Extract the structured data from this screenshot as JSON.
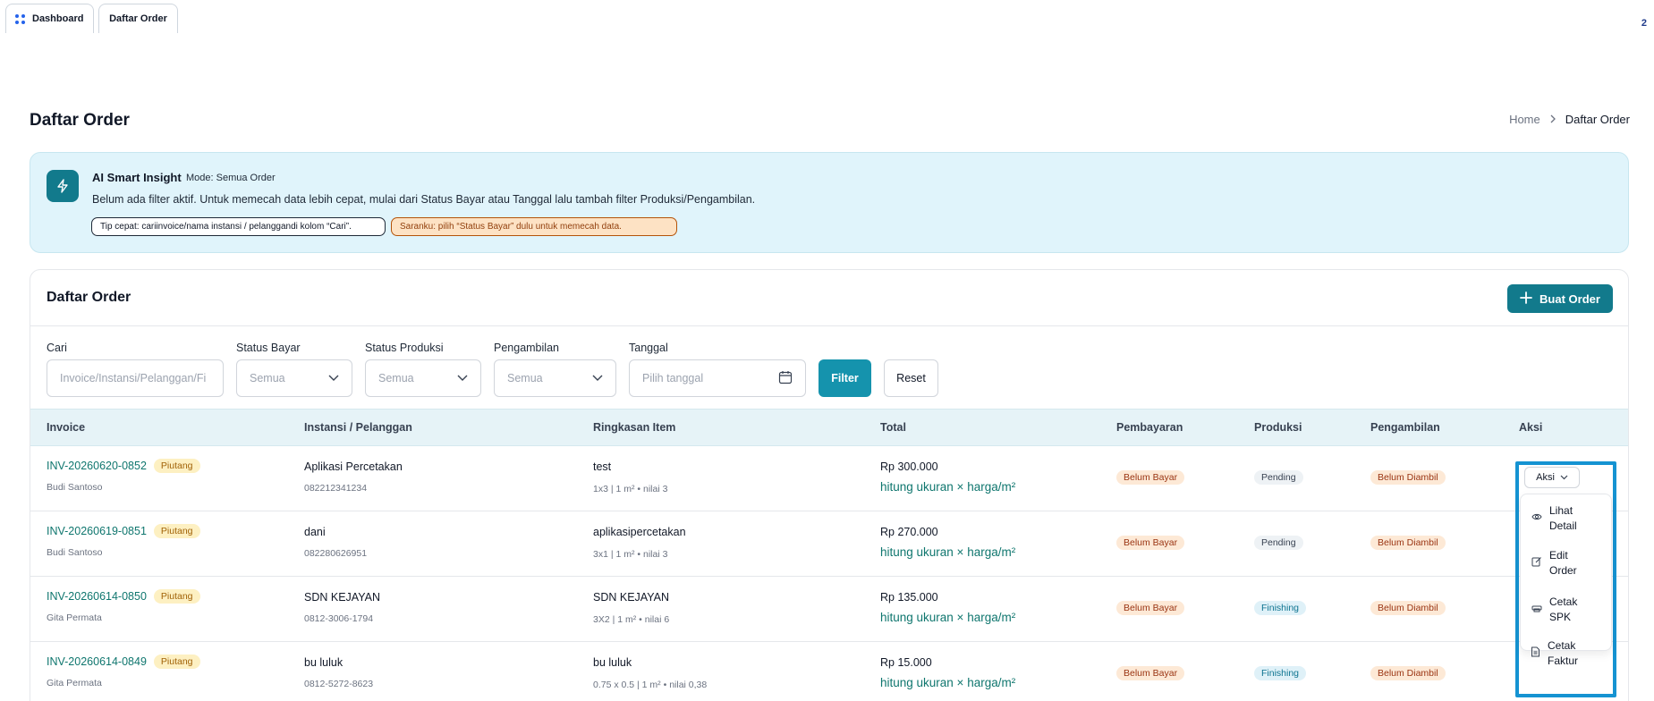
{
  "tabs": [
    {
      "label": "Dashboard"
    },
    {
      "label": "Daftar Order"
    }
  ],
  "corner_count": "2",
  "page": {
    "title": "Daftar Order",
    "breadcrumb": {
      "home": "Home",
      "current": "Daftar Order"
    }
  },
  "insight": {
    "title": "AI Smart Insight",
    "mode": "Mode: Semua Order",
    "message": "Belum ada filter aktif. Untuk memecah data lebih cepat, mulai dari Status Bayar atau Tanggal lalu tambah filter Produksi/Pengambilan.",
    "tip": "Tip cepat: cariinvoice/nama instansi / pelanggandi kolom “Cari”.",
    "saran": "Saranku: pilih “Status Bayar” dulu untuk memecah data."
  },
  "orders_card": {
    "title": "Daftar Order",
    "create_label": "Buat Order"
  },
  "filters": {
    "search": {
      "label": "Cari",
      "placeholder": "Invoice/Instansi/Pelanggan/Fi"
    },
    "status_bayar": {
      "label": "Status Bayar",
      "value": "Semua"
    },
    "status_produksi": {
      "label": "Status Produksi",
      "value": "Semua"
    },
    "pengambilan": {
      "label": "Pengambilan",
      "value": "Semua"
    },
    "tanggal": {
      "label": "Tanggal",
      "placeholder": "Pilih tanggal"
    },
    "filter_label": "Filter",
    "reset_label": "Reset"
  },
  "table": {
    "headers": {
      "invoice": "Invoice",
      "instansi": "Instansi / Pelanggan",
      "ringkasan": "Ringkasan Item",
      "total": "Total",
      "pembayaran": "Pembayaran",
      "produksi": "Produksi",
      "pengambilan": "Pengambilan",
      "aksi": "Aksi"
    },
    "rows": [
      {
        "invoice": "INV-20260620-0852",
        "tag": "Piutang",
        "staff": "Budi Santoso",
        "customer": "Aplikasi Percetakan",
        "phone": "082212341234",
        "item": "test",
        "item_detail": "1x3 | 1 m² • nilai 3",
        "total": "Rp 300.000",
        "total_note": "hitung ukuran × harga/m²",
        "pembayaran": "Belum Bayar",
        "produksi": "Pending",
        "pengambilan": "Belum Diambil"
      },
      {
        "invoice": "INV-20260619-0851",
        "tag": "Piutang",
        "staff": "Budi Santoso",
        "customer": "dani",
        "phone": "082280626951",
        "item": "aplikasipercetakan",
        "item_detail": "3x1 | 1 m² • nilai 3",
        "total": "Rp 270.000",
        "total_note": "hitung ukuran × harga/m²",
        "pembayaran": "Belum Bayar",
        "produksi": "Pending",
        "pengambilan": "Belum Diambil"
      },
      {
        "invoice": "INV-20260614-0850",
        "tag": "Piutang",
        "staff": "Gita Permata",
        "customer": "SDN KEJAYAN",
        "phone": "0812-3006-1794",
        "item": "SDN KEJAYAN",
        "item_detail": "3X2 | 1 m² • nilai 6",
        "total": "Rp 135.000",
        "total_note": "hitung ukuran × harga/m²",
        "pembayaran": "Belum Bayar",
        "produksi": "Finishing",
        "pengambilan": "Belum Diambil"
      },
      {
        "invoice": "INV-20260614-0849",
        "tag": "Piutang",
        "staff": "Gita Permata",
        "customer": "bu luluk",
        "phone": "0812-5272-8623",
        "item": "bu luluk",
        "item_detail": "0.75 x 0.5 | 1 m² • nilai 0,38",
        "total": "Rp 15.000",
        "total_note": "hitung ukuran × harga/m²",
        "pembayaran": "Belum Bayar",
        "produksi": "Finishing",
        "pengambilan": "Belum Diambil"
      }
    ]
  },
  "actions": {
    "button_label": "Aksi",
    "menu": {
      "view_line1": "Lihat",
      "view_line2": "Detail",
      "edit_line1": "Edit",
      "edit_line2": "Order",
      "spk_line1": "Cetak",
      "spk_line2": "SPK",
      "faktur_line1": "Cetak",
      "faktur_line2": "Faktur"
    }
  },
  "colors": {
    "primary": "#127a8c",
    "filter_button": "#1593ad",
    "highlight": "#1593d2",
    "insight_bg": "#e0f4fb"
  }
}
